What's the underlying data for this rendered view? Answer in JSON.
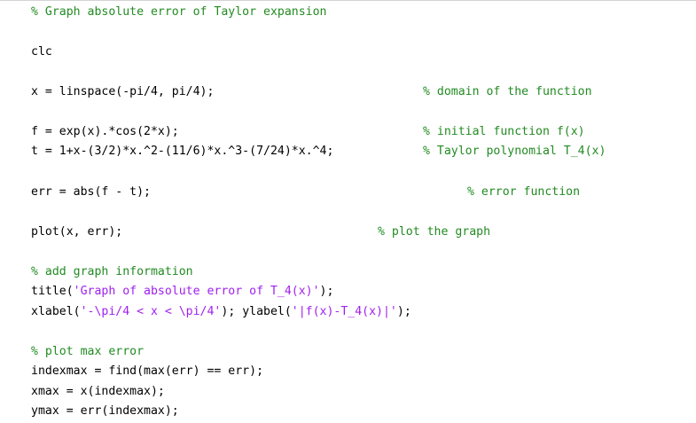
{
  "code": {
    "l1_comment": "% Graph absolute error of Taylor expansion",
    "l2_code": "clc",
    "l3_code": "x = linspace(-pi/4, pi/4);",
    "l3_comment": "% domain of the function",
    "l4_code": "f = exp(x).*cos(2*x);",
    "l4_comment": "% initial function f(x)",
    "l5_code": "t = 1+x-(3/2)*x.^2-(11/6)*x.^3-(7/24)*x.^4;",
    "l5_comment": "% Taylor polynomial T_4(x)",
    "l6_code": "err = abs(f - t);",
    "l6_comment": "% error function",
    "l7_code": "plot(x, err);",
    "l7_comment": "% plot the graph",
    "l8_comment": "% add graph information",
    "l9_fn": "title(",
    "l9_str": "'Graph of absolute error of T_4(x)'",
    "l9_end": ");",
    "l10_fn1": "xlabel(",
    "l10_str1": "'-\\pi/4 < x < \\pi/4'",
    "l10_mid": "); ylabel(",
    "l10_str2": "'|f(x)-T_4(x)|'",
    "l10_end": ");",
    "l11_comment": "% plot max error",
    "l12_code": "indexmax = find(max(err) == err);",
    "l13_code": "xmax = x(indexmax);",
    "l14_code": "ymax = err(indexmax);"
  }
}
